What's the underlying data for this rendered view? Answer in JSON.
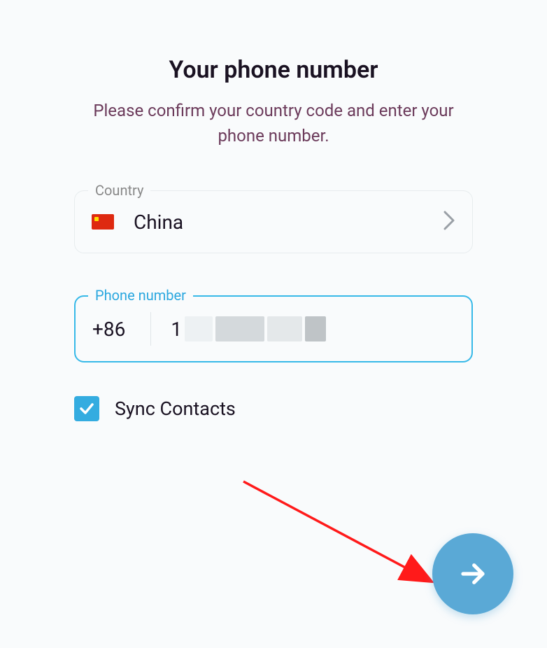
{
  "header": {
    "title": "Your phone number",
    "subtitle": "Please confirm your country code and enter your phone number."
  },
  "country_field": {
    "label": "Country",
    "flag": "china-flag",
    "name": "China"
  },
  "phone_field": {
    "label": "Phone number",
    "dial_code": "+86",
    "leading_digit": "1"
  },
  "sync": {
    "label": "Sync Contacts",
    "checked": true
  },
  "colors": {
    "accent": "#37b9e8",
    "fab": "#5aa9d6"
  }
}
